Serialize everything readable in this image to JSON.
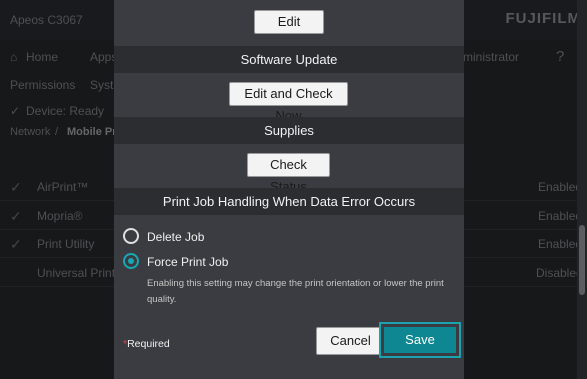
{
  "background": {
    "app_title": "Apeos C3067",
    "brand": "FUJIFILM",
    "nav": {
      "home": "Home",
      "apps": "Apps",
      "user": "ministrator"
    },
    "tabs": {
      "permissions": "Permissions",
      "system": "Syst"
    },
    "status": "Device: Ready",
    "breadcrumb": {
      "network": "Network",
      "separator": "/",
      "current": "Mobile Pr"
    },
    "rows": [
      {
        "name": "AirPrint™",
        "state": "Enabled"
      },
      {
        "name": "Mopria®",
        "state": "Enabled"
      },
      {
        "name": "Print Utility",
        "state": "Enabled"
      },
      {
        "name": "Universal Print",
        "state": "Disabled"
      }
    ]
  },
  "dialog": {
    "edit_label": "Edit",
    "software_update_title": "Software Update",
    "edit_check_now_label": "Edit and Check Now",
    "supplies_title": "Supplies",
    "check_status_label": "Check Status",
    "print_job_title": "Print Job Handling When Data Error Occurs",
    "options": [
      {
        "label": "Delete Job",
        "selected": false
      },
      {
        "label": "Force Print Job",
        "selected": true
      }
    ],
    "note": "Enabling this setting may change the print orientation or lower the print quality.",
    "required_star": "*",
    "required_label": "Required",
    "cancel_label": "Cancel",
    "save_label": "Save"
  },
  "colors": {
    "accent": "#18a7b5",
    "save_bg": "#0f8792",
    "required_star": "#e04646"
  }
}
